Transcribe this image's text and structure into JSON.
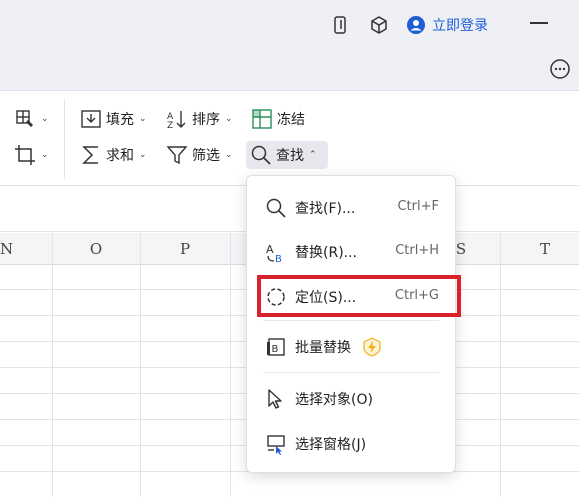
{
  "titlebar": {
    "icons": [
      "phone-icon",
      "cube-icon",
      "user-icon"
    ],
    "login_label": "立即登录"
  },
  "ribbon": {
    "fill_label": "填充",
    "sort_label": "排序",
    "freeze_label": "冻结",
    "sum_label": "求和",
    "filter_label": "筛选",
    "find_label": "查找"
  },
  "columns": [
    "N",
    "O",
    "P",
    "S",
    "T"
  ],
  "menu": {
    "items": [
      {
        "label": "查找(F)...",
        "shortcut": "Ctrl+F",
        "icon": "search-icon"
      },
      {
        "label": "替换(R)...",
        "shortcut": "Ctrl+H",
        "icon": "replace-icon"
      },
      {
        "label": "定位(S)...",
        "shortcut": "Ctrl+G",
        "icon": "locate-icon"
      },
      {
        "label": "批量替换",
        "shortcut": "",
        "icon": "batch-replace-icon"
      },
      {
        "label": "选择对象(O)",
        "shortcut": "",
        "icon": "cursor-icon"
      },
      {
        "label": "选择窗格(J)",
        "shortcut": "",
        "icon": "pane-icon"
      }
    ]
  },
  "colors": {
    "accent": "#1f5fd6",
    "highlight": "#d9232b",
    "vip": "#f2b21b"
  }
}
